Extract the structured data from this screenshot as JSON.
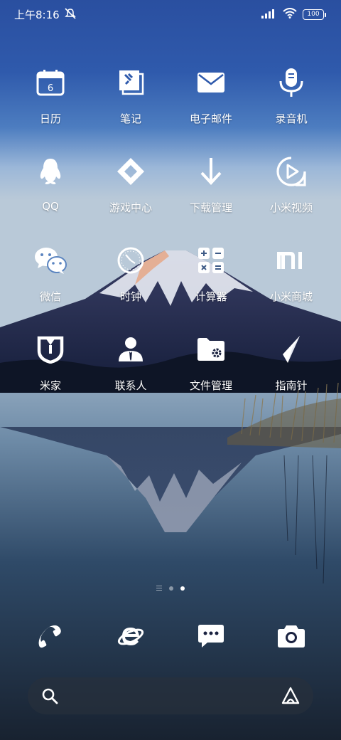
{
  "status": {
    "time": "上午8:16",
    "battery": "100"
  },
  "apps": [
    {
      "label": "日历",
      "icon": "calendar-icon",
      "calendar_day": "6"
    },
    {
      "label": "笔记",
      "icon": "notes-icon"
    },
    {
      "label": "电子邮件",
      "icon": "email-icon"
    },
    {
      "label": "录音机",
      "icon": "microphone-icon"
    },
    {
      "label": "QQ",
      "icon": "penguin-icon"
    },
    {
      "label": "游戏中心",
      "icon": "game-center-icon"
    },
    {
      "label": "下载管理",
      "icon": "download-icon"
    },
    {
      "label": "小米视频",
      "icon": "video-play-icon"
    },
    {
      "label": "微信",
      "icon": "wechat-icon"
    },
    {
      "label": "时钟",
      "icon": "clock-icon"
    },
    {
      "label": "计算器",
      "icon": "calculator-icon"
    },
    {
      "label": "小米商城",
      "icon": "mi-logo-icon"
    },
    {
      "label": "米家",
      "icon": "mijia-icon"
    },
    {
      "label": "联系人",
      "icon": "contact-person-icon"
    },
    {
      "label": "文件管理",
      "icon": "folder-gear-icon"
    },
    {
      "label": "指南针",
      "icon": "compass-icon"
    }
  ],
  "dock": [
    {
      "icon": "phone-icon"
    },
    {
      "icon": "browser-icon"
    },
    {
      "icon": "message-icon"
    },
    {
      "icon": "camera-icon"
    }
  ],
  "pages": {
    "count": 2,
    "active": 2
  }
}
